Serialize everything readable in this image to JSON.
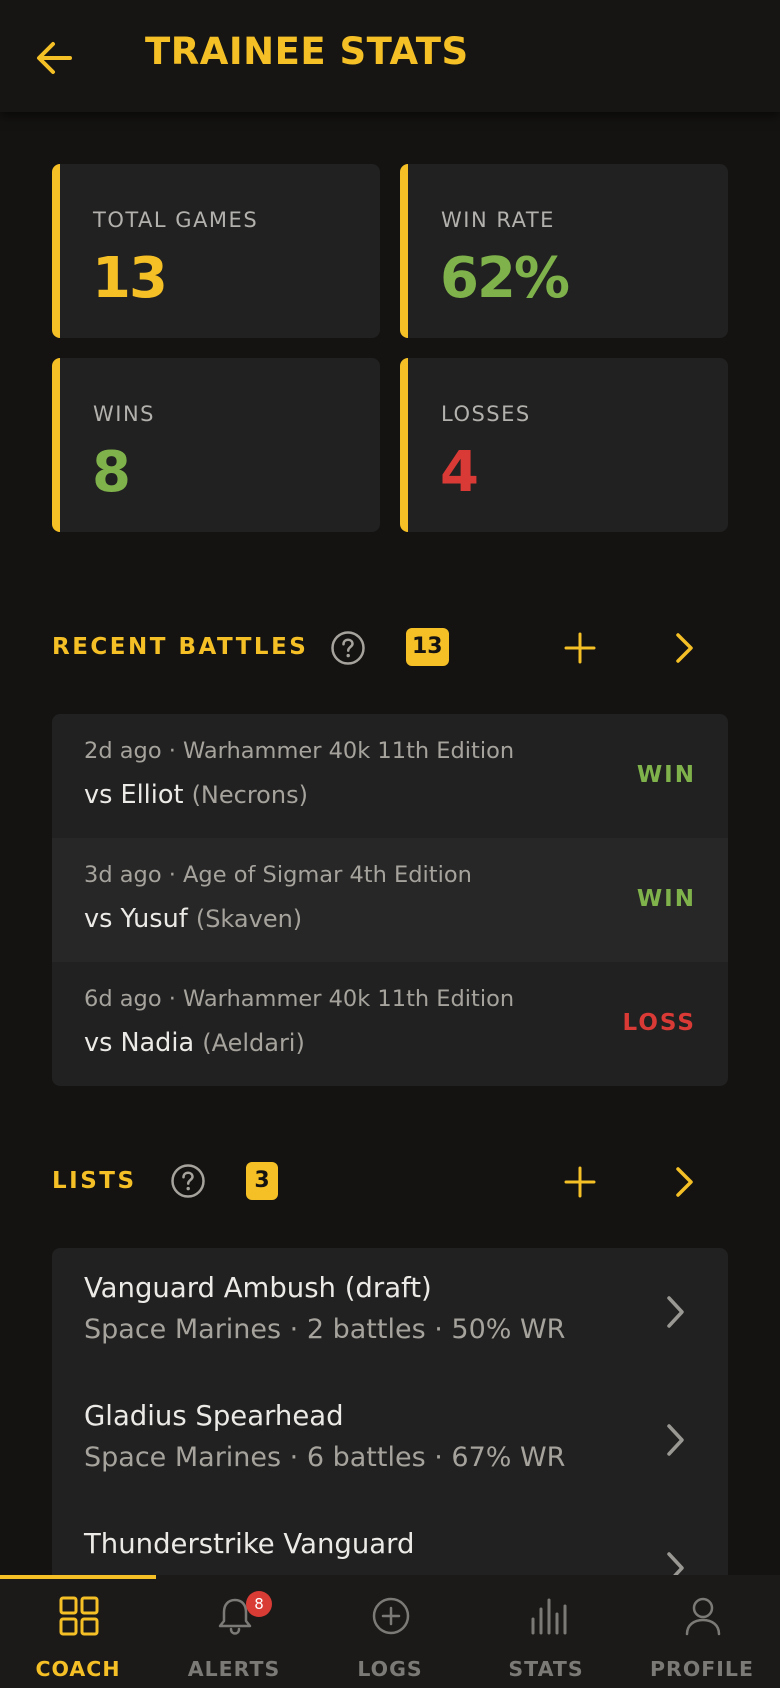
{
  "header": {
    "title": "TRAINEE STATS",
    "back_icon": "arrow-left-icon"
  },
  "stats": [
    {
      "label": "TOTAL GAMES",
      "value": "13",
      "color": "#f5bf26"
    },
    {
      "label": "WIN RATE",
      "value": "62%",
      "color": "#7fb24b"
    },
    {
      "label": "WINS",
      "value": "8",
      "color": "#7fb24b"
    },
    {
      "label": "LOSSES",
      "value": "4",
      "color": "#da3a35"
    }
  ],
  "recent_battles": {
    "title": "RECENT BATTLES",
    "count": "13",
    "items": [
      {
        "meta": "2d ago · Warhammer 40k 11th Edition",
        "opponent": "vs Elliot",
        "faction": "(Necrons)",
        "result": "WIN"
      },
      {
        "meta": "3d ago · Age of Sigmar 4th Edition",
        "opponent": "vs Yusuf",
        "faction": "(Skaven)",
        "result": "WIN"
      },
      {
        "meta": "6d ago · Warhammer 40k 11th Edition",
        "opponent": "vs Nadia",
        "faction": "(Aeldari)",
        "result": "LOSS"
      }
    ]
  },
  "lists": {
    "title": "LISTS",
    "count": "3",
    "items": [
      {
        "name": "Vanguard Ambush (draft)",
        "sub": "Space Marines · 2 battles · 50% WR"
      },
      {
        "name": "Gladius Spearhead",
        "sub": "Space Marines · 6 battles · 67% WR"
      },
      {
        "name": "Thunderstrike Vanguard",
        "sub": ""
      }
    ]
  },
  "nav": {
    "active": "COACH",
    "items": [
      {
        "label": "COACH",
        "icon": "grid-icon"
      },
      {
        "label": "ALERTS",
        "icon": "bell-icon",
        "badge": "8"
      },
      {
        "label": "LOGS",
        "icon": "plus-circle-icon"
      },
      {
        "label": "STATS",
        "icon": "bar-chart-icon"
      },
      {
        "label": "PROFILE",
        "icon": "user-icon"
      }
    ]
  },
  "colors": {
    "accent": "#f5bf26",
    "win": "#7fb24b",
    "loss": "#da3a35",
    "background": "#141311",
    "card": "#212121"
  }
}
